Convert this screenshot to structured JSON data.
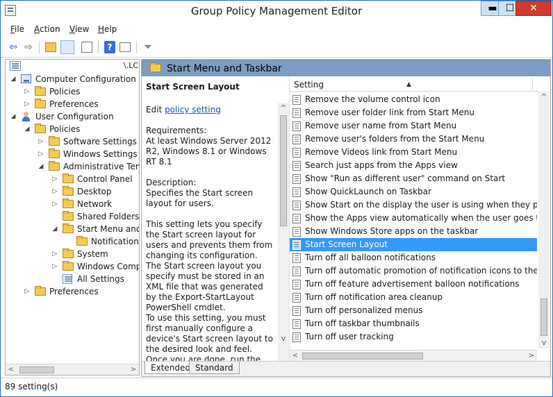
{
  "window": {
    "title": "Group Policy Management Editor",
    "minimize": "▬",
    "maximize": "☐",
    "close": "✕"
  },
  "menu": [
    {
      "key": "F",
      "rest": "ile"
    },
    {
      "key": "A",
      "rest": "ction"
    },
    {
      "key": "V",
      "rest": "iew"
    },
    {
      "key": "H",
      "rest": "elp"
    }
  ],
  "toolbar": {
    "back": "⇦",
    "forward": "⇨",
    "help": "?",
    "filter": "⏷"
  },
  "tree": {
    "root_suffix": "\\.LC",
    "items": [
      {
        "label": "Computer Configuration",
        "expander": "◢"
      },
      {
        "label": "Policies",
        "expander": "▷"
      },
      {
        "label": "Preferences",
        "expander": "▷"
      },
      {
        "label": "User Configuration",
        "expander": "◢"
      },
      {
        "label": "Policies",
        "expander": "◢"
      },
      {
        "label": "Software Settings",
        "expander": "▷"
      },
      {
        "label": "Windows Settings",
        "expander": "▷"
      },
      {
        "label": "Administrative Temp",
        "expander": "◢"
      },
      {
        "label": "Control Panel",
        "expander": "▷"
      },
      {
        "label": "Desktop",
        "expander": "▷"
      },
      {
        "label": "Network",
        "expander": "▷"
      },
      {
        "label": "Shared Folders",
        "expander": ""
      },
      {
        "label": "Start Menu and T",
        "expander": "◢"
      },
      {
        "label": "Notifications",
        "expander": ""
      },
      {
        "label": "System",
        "expander": "▷"
      },
      {
        "label": "Windows Compo",
        "expander": "▷"
      },
      {
        "label": "All Settings",
        "expander": ""
      },
      {
        "label": "Preferences",
        "expander": "▷"
      }
    ]
  },
  "pane": {
    "header": "Start Menu and Taskbar",
    "column_setting": "Setting",
    "desc": {
      "title": "Start Screen Layout",
      "edit_prefix": "Edit ",
      "edit_link": "policy setting",
      "req_label": "Requirements:",
      "req_text": "At least Windows Server 2012 R2, Windows 8.1 or Windows RT 8.1",
      "desc_label": "Description:",
      "desc_text": "Specifies the Start screen layout for users.",
      "para1": "This setting lets you specify the Start screen layout for users and prevents them from changing its configuration. The Start screen layout you specify must be stored in an XML file that was generated by the Export-StartLayout PowerShell cmdlet.",
      "para2": "To use this setting, you must first manually configure a device's Start screen layout to the desired look and feel. Once you are  done, run the Export-StartLayout PowerShell cmdlet on that same device. The cmdlet will generate"
    },
    "settings": [
      "Remove the volume control icon",
      "Remove user folder link from Start Menu",
      "Remove user name from Start Menu",
      "Remove user's folders from the Start Menu",
      "Remove Videos link from Start Menu",
      "Search just apps from the Apps view",
      "Show \"Run as different user\" command on Start",
      "Show QuickLaunch on Taskbar",
      "Show Start on the display the user is using when they press t...",
      "Show the Apps view automatically when the user goes to St...",
      "Show Windows Store apps on the taskbar",
      "Start Screen Layout",
      "Turn off all balloon notifications",
      "Turn off automatic promotion of notification icons to the ta...",
      "Turn off feature advertisement balloon notifications",
      "Turn off notification area cleanup",
      "Turn off personalized menus",
      "Turn off taskbar thumbnails",
      "Turn off user tracking"
    ],
    "selected_index": 11,
    "tabs": [
      "Extended",
      "Standard"
    ]
  },
  "status": "89 setting(s)"
}
